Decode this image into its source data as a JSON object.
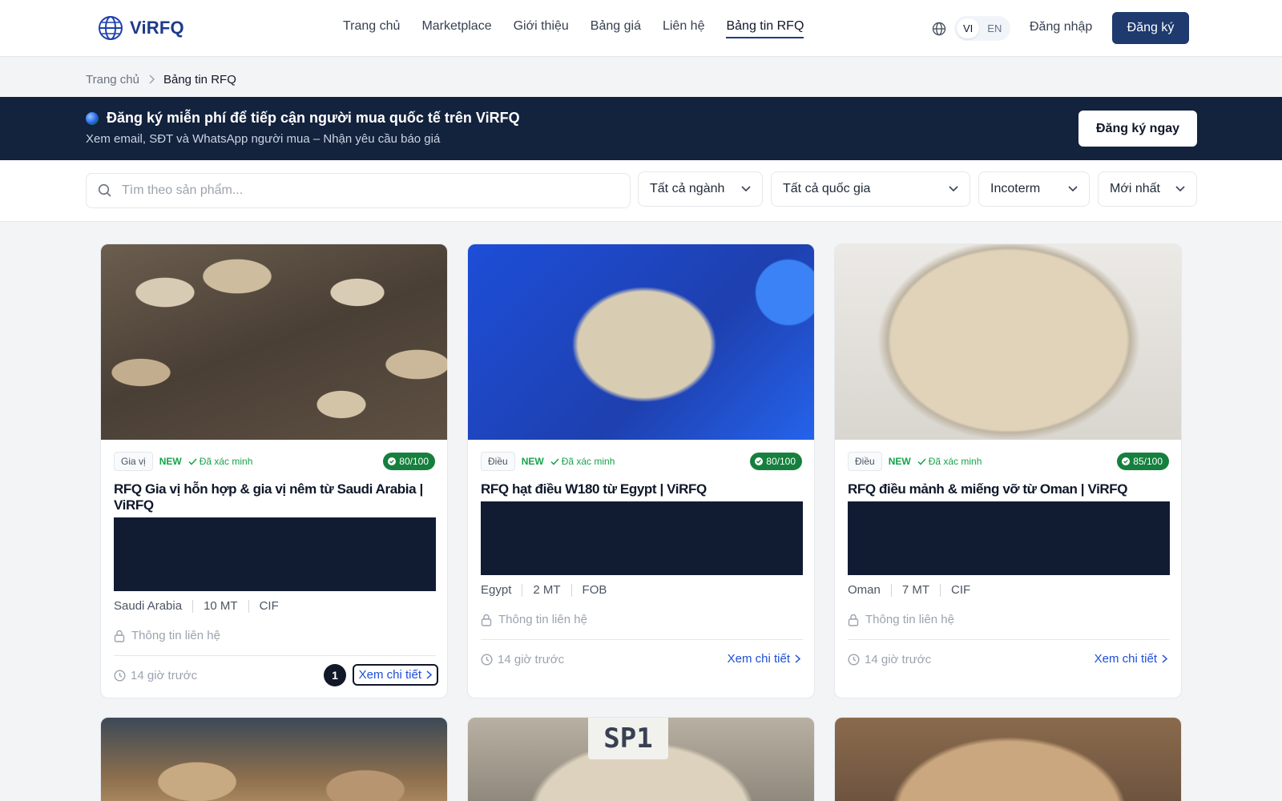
{
  "header": {
    "logo_text": "ViRFQ",
    "nav": [
      "Trang chủ",
      "Marketplace",
      "Giới thiệu",
      "Bảng giá",
      "Liên hệ",
      "Bảng tin RFQ"
    ],
    "lang_vi": "VI",
    "lang_en": "EN",
    "login": "Đăng nhập",
    "signup": "Đăng ký"
  },
  "breadcrumb": {
    "home": "Trang chủ",
    "current": "Bảng tin RFQ"
  },
  "banner": {
    "title": "Đăng ký miễn phí để tiếp cận người mua quốc tế trên ViRFQ",
    "subtitle": "Xem email, SĐT và WhatsApp người mua – Nhận yêu cầu báo giá",
    "cta": "Đăng ký ngay"
  },
  "filters": {
    "search_placeholder": "Tìm theo sản phẩm...",
    "industry": "Tất cả ngành",
    "country": "Tất cả quốc gia",
    "incoterm": "Incoterm",
    "sort": "Mới nhất"
  },
  "cards": [
    {
      "category": "Gia vị",
      "new": "NEW",
      "verified": "Đã xác minh",
      "score": "80/100",
      "title": "RFQ Gia vị hỗn hợp & gia vị nêm từ Saudi Arabia | ViRFQ",
      "country": "Saudi Arabia",
      "qty": "10 MT",
      "incoterm": "CIF",
      "contact": "Thông tin liên hệ",
      "time": "14 giờ trước",
      "detail": "Xem chi tiết",
      "badge": "1"
    },
    {
      "category": "Điều",
      "new": "NEW",
      "verified": "Đã xác minh",
      "score": "80/100",
      "title": "RFQ hạt điều W180 từ Egypt | ViRFQ",
      "country": "Egypt",
      "qty": "2 MT",
      "incoterm": "FOB",
      "contact": "Thông tin liên hệ",
      "time": "14 giờ trước",
      "detail": "Xem chi tiết"
    },
    {
      "category": "Điều",
      "new": "NEW",
      "verified": "Đã xác minh",
      "score": "85/100",
      "title": "RFQ điều mảnh & miếng vỡ từ Oman | ViRFQ",
      "country": "Oman",
      "qty": "7 MT",
      "incoterm": "CIF",
      "contact": "Thông tin liên hệ",
      "time": "14 giờ trước",
      "detail": "Xem chi tiết"
    }
  ],
  "row2": {
    "sp1_label": "SP1"
  },
  "colors": {
    "brand": "#1e3a6e",
    "banner": "#13223d",
    "verified": "#16a34a",
    "link": "#1d4ed8"
  }
}
